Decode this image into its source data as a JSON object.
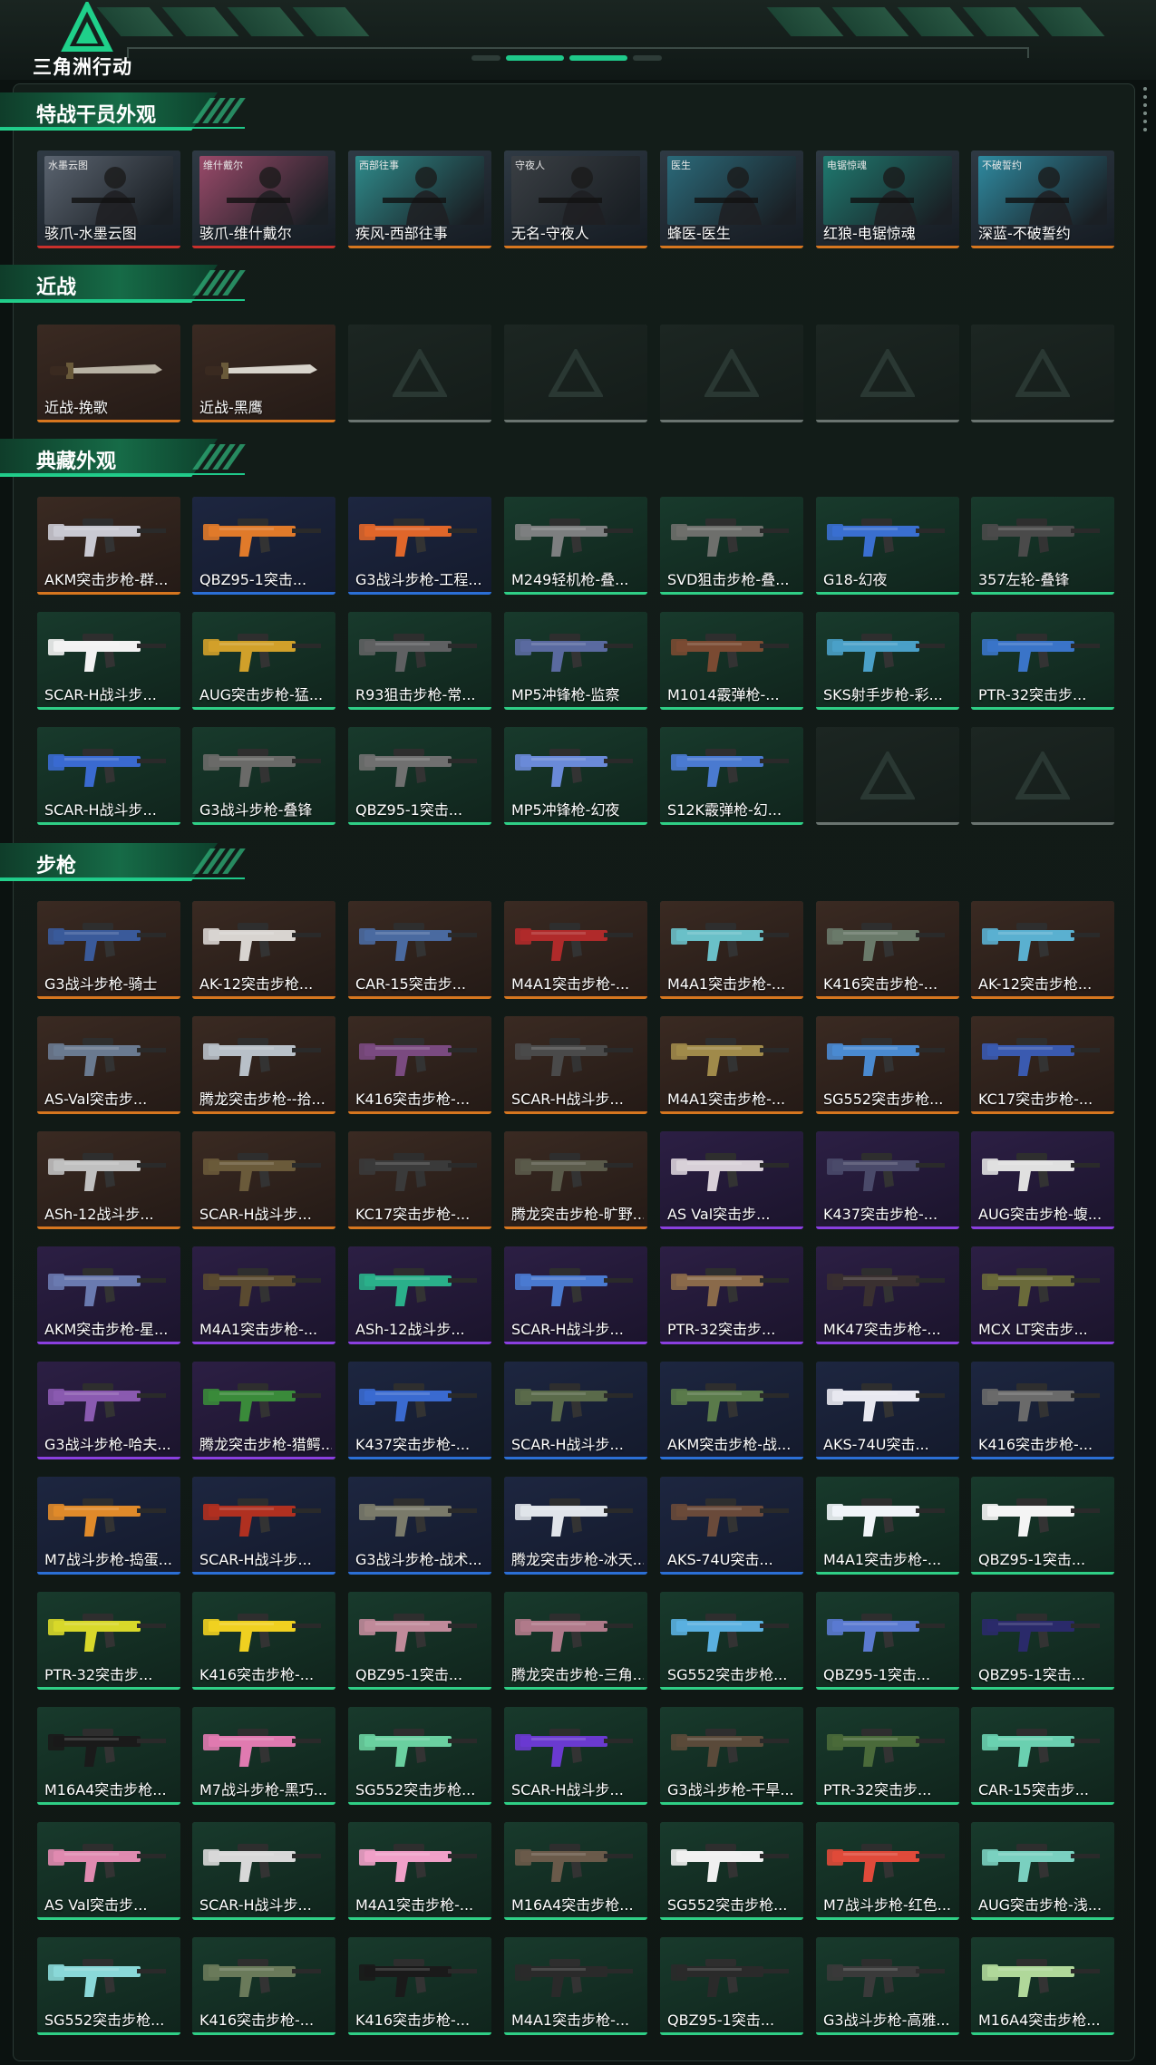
{
  "logo": {
    "text": "三角洲行动",
    "icon": "delta-triangle-logo-icon"
  },
  "sections": [
    {
      "key": "operators",
      "title": "特战干员外观"
    },
    {
      "key": "melee",
      "title": "近战"
    },
    {
      "key": "collection",
      "title": "典藏外观"
    },
    {
      "key": "rifles",
      "title": "步枪"
    }
  ],
  "operators": [
    {
      "label": "骇爪-水墨云图",
      "tag": "水墨云图",
      "rarity": "red",
      "tone": "#5b6470"
    },
    {
      "label": "骇爪-维什戴尔",
      "tag": "维什戴尔",
      "rarity": "red",
      "tone": "#9a4a6a"
    },
    {
      "label": "疾风-西部往事",
      "tag": "西部往事",
      "rarity": "orange",
      "tone": "#2f8c8c"
    },
    {
      "label": "无名-守夜人",
      "tag": "守夜人",
      "rarity": "orange",
      "tone": "#3a3f44"
    },
    {
      "label": "蜂医-医生",
      "tag": "医生",
      "rarity": "orange",
      "tone": "#2b6a7a"
    },
    {
      "label": "红狼-电锯惊魂",
      "tag": "电锯惊魂",
      "rarity": "orange",
      "tone": "#1f7a70"
    },
    {
      "label": "深蓝-不破誓约",
      "tag": "不破誓约",
      "rarity": "orange",
      "tone": "#2f8aa0"
    }
  ],
  "melee": [
    {
      "label": "近战-挽歌",
      "rarity": "orange",
      "color": "#b8b2a4"
    },
    {
      "label": "近战-黑鹰",
      "rarity": "orange",
      "color": "#d8d4cc"
    }
  ],
  "melee_empty_count": 5,
  "collection": [
    {
      "label": "AKM突击步枪-群...",
      "rarity": "orange",
      "color": "#c9c9d2"
    },
    {
      "label": "QBZ95-1突击...",
      "rarity": "blue",
      "color": "#e07a2a"
    },
    {
      "label": "G3战斗步枪-工程...",
      "rarity": "blue",
      "color": "#e0662a"
    },
    {
      "label": "M249轻机枪-叠...",
      "rarity": "green",
      "color": "#7d7f80"
    },
    {
      "label": "SVD狙击步枪-叠...",
      "rarity": "green",
      "color": "#6e6f6c"
    },
    {
      "label": "G18-幻夜",
      "rarity": "green",
      "color": "#3a6fd0"
    },
    {
      "label": "357左轮-叠锋",
      "rarity": "green",
      "color": "#4a4a4a"
    },
    {
      "label": "SCAR-H战斗步...",
      "rarity": "green",
      "color": "#f2f2f2"
    },
    {
      "label": "AUG突击步枪-猛...",
      "rarity": "green",
      "color": "#d1a02a"
    },
    {
      "label": "R93狙击步枪-常...",
      "rarity": "green",
      "color": "#5f6062"
    },
    {
      "label": "MP5冲锋枪-监察",
      "rarity": "green",
      "color": "#5a6aa0"
    },
    {
      "label": "M1014霰弹枪-...",
      "rarity": "green",
      "color": "#7a4a32"
    },
    {
      "label": "SKS射手步枪-彩...",
      "rarity": "green",
      "color": "#4aa0c8"
    },
    {
      "label": "PTR-32突击步...",
      "rarity": "green",
      "color": "#3a74c8"
    },
    {
      "label": "SCAR-H战斗步...",
      "rarity": "green",
      "color": "#3a6ad0"
    },
    {
      "label": "G3战斗步枪-叠锋",
      "rarity": "green",
      "color": "#6a6a68"
    },
    {
      "label": "QBZ95-1突击...",
      "rarity": "green",
      "color": "#707070"
    },
    {
      "label": "MP5冲锋枪-幻夜",
      "rarity": "green",
      "color": "#6a8ad8"
    },
    {
      "label": "S12K霰弹枪-幻...",
      "rarity": "green",
      "color": "#4a7ad0"
    }
  ],
  "collection_empty_count": 2,
  "rifles": [
    {
      "label": "G3战斗步枪-骑士",
      "rarity": "orange",
      "color": "#3a5a9a"
    },
    {
      "label": "AK-12突击步枪...",
      "rarity": "orange",
      "color": "#d8d4d0"
    },
    {
      "label": "CAR-15突击步...",
      "rarity": "orange",
      "color": "#4a6aa0"
    },
    {
      "label": "M4A1突击步枪-...",
      "rarity": "orange",
      "color": "#b02a2a"
    },
    {
      "label": "M4A1突击步枪-...",
      "rarity": "orange",
      "color": "#6ac0c8"
    },
    {
      "label": "K416突击步枪-...",
      "rarity": "orange",
      "color": "#6a7a6a"
    },
    {
      "label": "AK-12突击步枪...",
      "rarity": "orange",
      "color": "#5ab0d0"
    },
    {
      "label": "AS-Val突击步...",
      "rarity": "orange",
      "color": "#6a7a90"
    },
    {
      "label": "腾龙突击步枪--拾...",
      "rarity": "orange",
      "color": "#b8c0c8"
    },
    {
      "label": "K416突击步枪-...",
      "rarity": "orange",
      "color": "#7a4a80"
    },
    {
      "label": "SCAR-H战斗步...",
      "rarity": "orange",
      "color": "#4a4a4a"
    },
    {
      "label": "M4A1突击步枪-...",
      "rarity": "orange",
      "color": "#a08a4a"
    },
    {
      "label": "SG552突击步枪...",
      "rarity": "orange",
      "color": "#4a8ad0"
    },
    {
      "label": "KC17突击步枪-...",
      "rarity": "orange",
      "color": "#3a5ab0"
    },
    {
      "label": "ASh-12战斗步...",
      "rarity": "orange",
      "color": "#c0c0c0"
    },
    {
      "label": "SCAR-H战斗步...",
      "rarity": "orange",
      "color": "#6a5a3a"
    },
    {
      "label": "KC17突击步枪-...",
      "rarity": "orange",
      "color": "#3a3a3a"
    },
    {
      "label": "腾龙突击步枪-旷野...",
      "rarity": "orange",
      "color": "#5a5a4a"
    },
    {
      "label": "AS Val突击步...",
      "rarity": "purple",
      "color": "#d8d0d8"
    },
    {
      "label": "K437突击步枪-...",
      "rarity": "purple",
      "color": "#4a4a6a"
    },
    {
      "label": "AUG突击步枪-蝮...",
      "rarity": "purple",
      "color": "#e0e0e0"
    },
    {
      "label": "AKM突击步枪-星...",
      "rarity": "purple",
      "color": "#6a7ab0"
    },
    {
      "label": "M4A1突击步枪-...",
      "rarity": "purple",
      "color": "#5a4a30"
    },
    {
      "label": "ASh-12战斗步...",
      "rarity": "purple",
      "color": "#2ab08a"
    },
    {
      "label": "SCAR-H战斗步...",
      "rarity": "purple",
      "color": "#4a7ad0"
    },
    {
      "label": "PTR-32突击步...",
      "rarity": "purple",
      "color": "#8a6a4a"
    },
    {
      "label": "MK47突击步枪-...",
      "rarity": "purple",
      "color": "#3a3030"
    },
    {
      "label": "MCX LT突击步...",
      "rarity": "purple",
      "color": "#6a6a3a"
    },
    {
      "label": "G3战斗步枪-哈夫...",
      "rarity": "purple",
      "color": "#8a5ab0"
    },
    {
      "label": "腾龙突击步枪-猎鳄...",
      "rarity": "purple",
      "color": "#3a8a3a"
    },
    {
      "label": "K437突击步枪-...",
      "rarity": "blue",
      "color": "#3a6ad0"
    },
    {
      "label": "SCAR-H战斗步...",
      "rarity": "blue",
      "color": "#5a6a4a"
    },
    {
      "label": "AKM突击步枪-战...",
      "rarity": "blue",
      "color": "#5a7a4a"
    },
    {
      "label": "AKS-74U突击...",
      "rarity": "blue",
      "color": "#e8e8f0"
    },
    {
      "label": "K416突击步枪-...",
      "rarity": "blue",
      "color": "#6a6a6a"
    },
    {
      "label": "M7战斗步枪-捣蛋...",
      "rarity": "blue",
      "color": "#e08a2a"
    },
    {
      "label": "SCAR-H战斗步...",
      "rarity": "blue",
      "color": "#b03020"
    },
    {
      "label": "G3战斗步枪-战术...",
      "rarity": "blue",
      "color": "#7a7a6a"
    },
    {
      "label": "腾龙突击步枪-冰天...",
      "rarity": "blue",
      "color": "#e0e4ea"
    },
    {
      "label": "AKS-74U突击...",
      "rarity": "blue",
      "color": "#6a4a3a"
    },
    {
      "label": "M4A1突击步枪-...",
      "rarity": "green",
      "color": "#f0f4f8"
    },
    {
      "label": "QBZ95-1突击...",
      "rarity": "green",
      "color": "#f4f4f4"
    },
    {
      "label": "PTR-32突击步...",
      "rarity": "green",
      "color": "#d8d82a"
    },
    {
      "label": "K416突击步枪-...",
      "rarity": "green",
      "color": "#f0d020"
    },
    {
      "label": "QBZ95-1突击...",
      "rarity": "green",
      "color": "#c08a9a"
    },
    {
      "label": "腾龙突击步枪-三角...",
      "rarity": "green",
      "color": "#b07a8a"
    },
    {
      "label": "SG552突击步枪...",
      "rarity": "green",
      "color": "#5ab0e0"
    },
    {
      "label": "QBZ95-1突击...",
      "rarity": "green",
      "color": "#5a7ad0"
    },
    {
      "label": "QBZ95-1突击...",
      "rarity": "green",
      "color": "#2a2a6a"
    },
    {
      "label": "M16A4突击步枪...",
      "rarity": "green",
      "color": "#1a1a1a"
    },
    {
      "label": "M7战斗步枪-黑巧...",
      "rarity": "green",
      "color": "#e07ab0"
    },
    {
      "label": "SG552突击步枪...",
      "rarity": "green",
      "color": "#6ad0a0"
    },
    {
      "label": "SCAR-H战斗步...",
      "rarity": "green",
      "color": "#6a3ad0"
    },
    {
      "label": "G3战斗步枪-干旱...",
      "rarity": "green",
      "color": "#5a4a3a"
    },
    {
      "label": "PTR-32突击步...",
      "rarity": "green",
      "color": "#4a6a3a"
    },
    {
      "label": "CAR-15突击步...",
      "rarity": "green",
      "color": "#6ad0b0"
    },
    {
      "label": "AS Val突击步...",
      "rarity": "green",
      "color": "#e08ab0"
    },
    {
      "label": "SCAR-H战斗步...",
      "rarity": "green",
      "color": "#d8d8d8"
    },
    {
      "label": "M4A1突击步枪-...",
      "rarity": "green",
      "color": "#f0a0c8"
    },
    {
      "label": "M16A4突击步枪...",
      "rarity": "green",
      "color": "#6a5a4a"
    },
    {
      "label": "SG552突击步枪...",
      "rarity": "green",
      "color": "#f0f0f0"
    },
    {
      "label": "M7战斗步枪-红色...",
      "rarity": "green",
      "color": "#e04a3a"
    },
    {
      "label": "AUG突击步枪-浅...",
      "rarity": "green",
      "color": "#7ad0c0"
    },
    {
      "label": "SG552突击步枪...",
      "rarity": "green",
      "color": "#8ad8d8"
    },
    {
      "label": "K416突击步枪-...",
      "rarity": "green",
      "color": "#6a7a5a"
    },
    {
      "label": "K416突击步枪-...",
      "rarity": "green",
      "color": "#1a1a1a"
    },
    {
      "label": "M4A1突击步枪-...",
      "rarity": "green",
      "color": "#2a2a2a"
    },
    {
      "label": "QBZ95-1突击...",
      "rarity": "green",
      "color": "#2a2a2a"
    },
    {
      "label": "G3战斗步枪-高雅...",
      "rarity": "green",
      "color": "#3a3a3a"
    },
    {
      "label": "M16A4突击步枪...",
      "rarity": "green",
      "color": "#b0d89a"
    }
  ]
}
